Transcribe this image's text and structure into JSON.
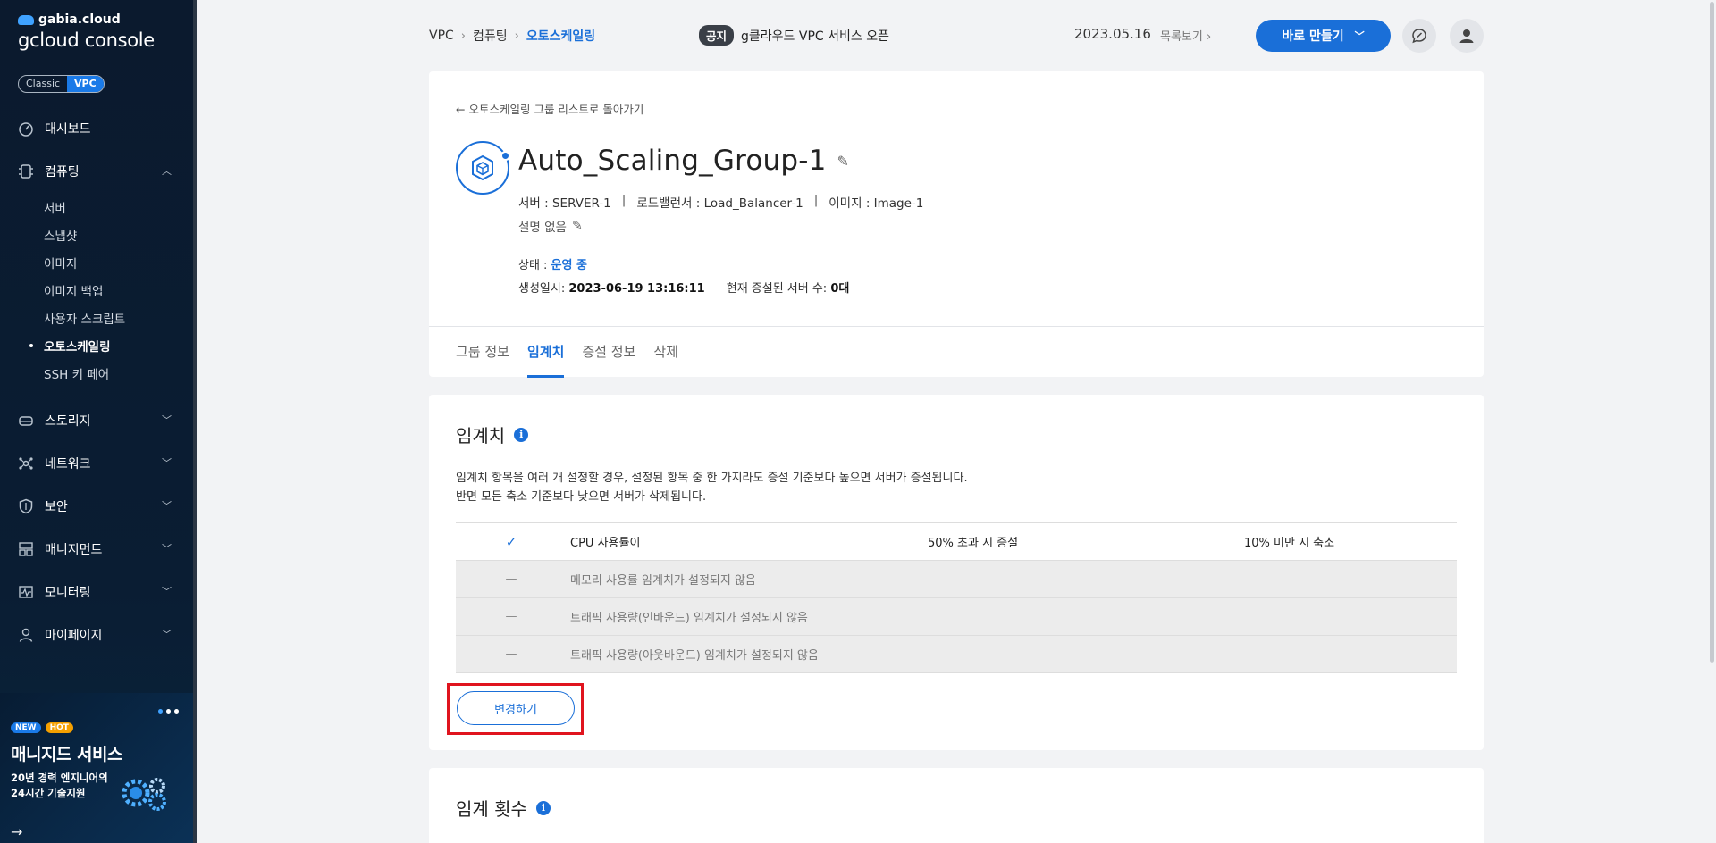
{
  "brand": {
    "top": "gabia.cloud",
    "name": "gcloud console"
  },
  "mode": {
    "classic": "Classic",
    "vpc": "VPC"
  },
  "nav": {
    "dashboard": "대시보드",
    "computing": "컴퓨팅",
    "computing_sub": [
      "서버",
      "스냅샷",
      "이미지",
      "이미지 백업",
      "사용자 스크립트",
      "오토스케일링",
      "SSH 키 페어"
    ],
    "storage": "스토리지",
    "network": "네트워크",
    "security": "보안",
    "management": "매니지먼트",
    "monitoring": "모니터링",
    "mypage": "마이페이지"
  },
  "promo": {
    "badge_new": "NEW",
    "badge_hot": "HOT",
    "title": "매니지드 서비스",
    "desc1": "20년 경력 엔지니어의",
    "desc2": "24시간 기술지원"
  },
  "header": {
    "breadcrumb": [
      "VPC",
      "컴퓨팅",
      "오토스케일링"
    ],
    "notice_tag": "공지",
    "notice_text": "g클라우드 VPC 서비스 오픈",
    "notice_date": "2023.05.16",
    "list_link": "목록보기",
    "create_btn": "바로 만들기"
  },
  "group": {
    "back": "오토스케일링 그룹 리스트로 돌아가기",
    "title": "Auto_Scaling_Group-1",
    "server": "서버 : SERVER-1",
    "lb": "로드밸런서 : Load_Balancer-1",
    "image": "이미지 : Image-1",
    "desc": "설명 없음",
    "status_label": "상태 :",
    "status_value": "운영 중",
    "created_label": "생성일시:",
    "created_value": "2023-06-19 13:16:11",
    "servers_label": "현재 증설된 서버 수:",
    "servers_value": "0대"
  },
  "tabs": [
    "그룹 정보",
    "임계치",
    "증설 정보",
    "삭제"
  ],
  "threshold": {
    "title": "임계치",
    "desc1": "임계치 항목을 여러 개 설정할 경우, 설정된 항목 중 한 가지라도 증설 기준보다 높으면 서버가 증설됩니다.",
    "desc2": "반면 모든 축소 기준보다 낮으면 서버가 삭제됩니다.",
    "rows": [
      {
        "mark": "✓",
        "label": "CPU 사용률이",
        "up": "50% 초과 시 증설",
        "down": "10% 미만 시 축소"
      },
      {
        "mark": "—",
        "label": "메모리 사용률 임계치가 설정되지 않음",
        "up": "",
        "down": ""
      },
      {
        "mark": "—",
        "label": "트래픽 사용량(인바운드) 임계치가 설정되지 않음",
        "up": "",
        "down": ""
      },
      {
        "mark": "—",
        "label": "트래픽 사용량(아웃바운드) 임계치가 설정되지 않음",
        "up": "",
        "down": ""
      }
    ],
    "change_btn": "변경하기"
  },
  "count": {
    "title": "임계 횟수"
  },
  "colors": {
    "accent": "#1a6fd8",
    "highlight": "#e0141e",
    "sidebar": "#0b1a2e"
  }
}
